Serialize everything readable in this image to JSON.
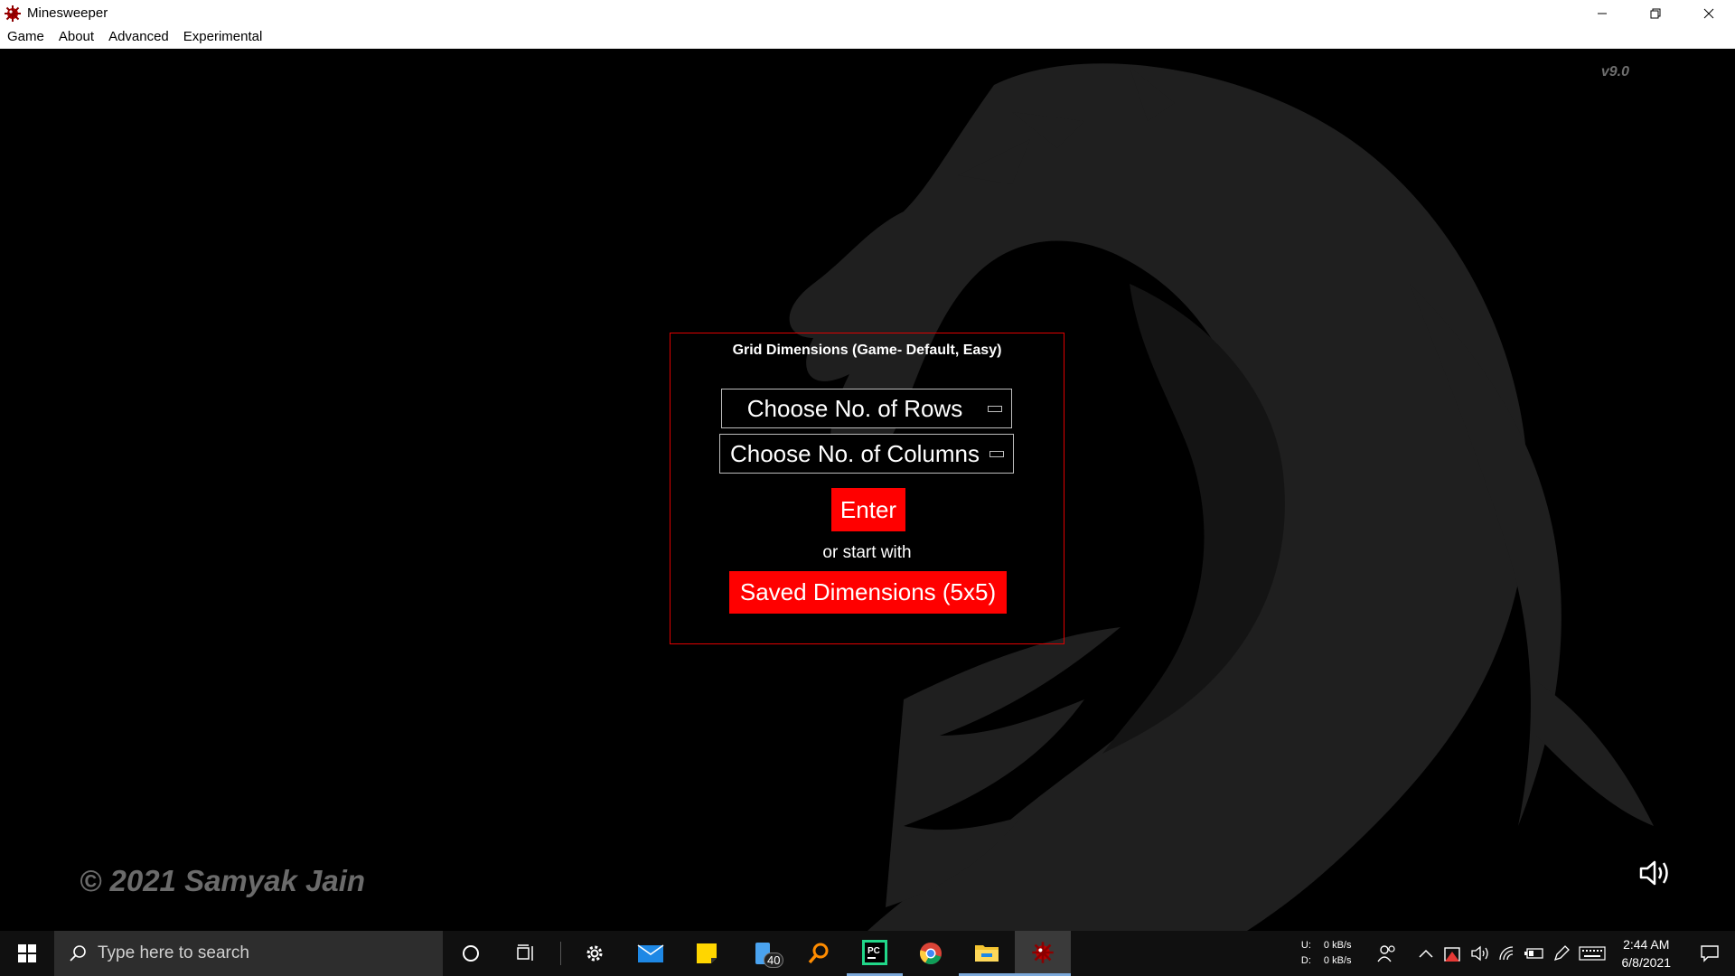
{
  "window": {
    "title": "Minesweeper"
  },
  "menu": {
    "items": [
      "Game",
      "About",
      "Advanced",
      "Experimental"
    ]
  },
  "game": {
    "version": "v9.0",
    "panel": {
      "title": "Grid Dimensions (Game- Default, Easy)",
      "rows_value": "Choose No. of Rows",
      "columns_value": "Choose No. of Columns",
      "enter_label": "Enter",
      "or_text": "or start with",
      "saved_label": "Saved Dimensions (5x5)"
    },
    "copyright": "© 2021 Samyak Jain"
  },
  "taskbar": {
    "search_placeholder": "Type here to search",
    "badge_count": "40",
    "net_up_label": "U:",
    "net_down_label": "D:",
    "net_up_value": "0 kB/s",
    "net_down_value": "0 kB/s",
    "time": "2:44 AM",
    "date": "6/8/2021"
  },
  "colors": {
    "accent_red": "#ff0000",
    "panel_border": "#e00000",
    "background": "#000000"
  }
}
